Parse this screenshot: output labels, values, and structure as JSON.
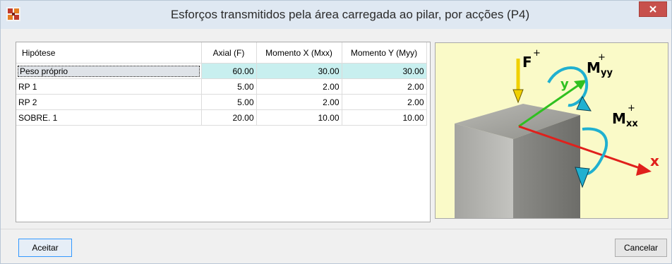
{
  "window": {
    "title": "Esforços transmitidos pela área carregada ao pilar, por acções (P4)"
  },
  "table": {
    "columns": [
      "Hipótese",
      "Axial (F)",
      "Momento X (Mxx)",
      "Momento Y (Myy)"
    ],
    "rows": [
      {
        "hypothesis": "Peso próprio",
        "axial": "60.00",
        "mx": "30.00",
        "my": "30.00",
        "selected": true
      },
      {
        "hypothesis": "RP 1",
        "axial": "5.00",
        "mx": "2.00",
        "my": "2.00"
      },
      {
        "hypothesis": "RP 2",
        "axial": "5.00",
        "mx": "2.00",
        "my": "2.00"
      },
      {
        "hypothesis": "SOBRE. 1",
        "axial": "20.00",
        "mx": "10.00",
        "my": "10.00"
      }
    ]
  },
  "diagram": {
    "force_label": "F",
    "plus": "+",
    "myy_label": "M",
    "myy_sub": "yy",
    "mxx_label": "M",
    "mxx_sub": "xx",
    "y_label": "y",
    "x_label": "x"
  },
  "buttons": {
    "accept": "Aceitar",
    "cancel": "Cancelar"
  },
  "colors": {
    "selected_row": "#c8efef",
    "preview_bg": "#fafac8",
    "close_button": "#c7504c",
    "x_axis": "#e0201c",
    "y_axis": "#30c020",
    "force_arrow": "#f0d000",
    "moment_arrow": "#20b0d0"
  }
}
